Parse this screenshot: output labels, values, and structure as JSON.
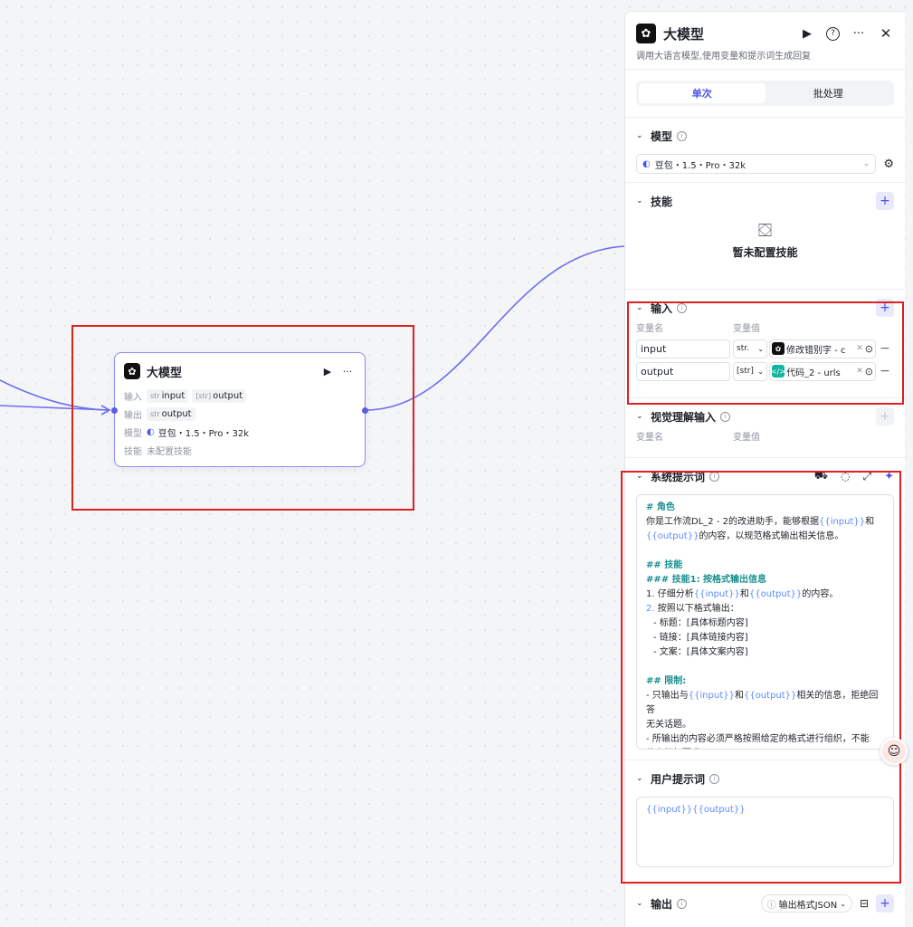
{
  "node": {
    "title": "大模型",
    "input_label": "输入",
    "output_label": "输出",
    "model_label": "模型",
    "skill_label": "技能",
    "inputs": [
      {
        "type": "str",
        "name": "input"
      },
      {
        "type": "[str]",
        "name": "output"
      }
    ],
    "outputs": [
      {
        "type": "str",
        "name": "output"
      }
    ],
    "model": "豆包・1.5・Pro・32k",
    "skill": "未配置技能"
  },
  "panel": {
    "title": "大模型",
    "desc": "调用大语言模型,使用变量和提示词生成回复",
    "tabs": [
      "单次",
      "批处理"
    ],
    "model_section": {
      "title": "模型",
      "selected": "豆包・1.5・Pro・32k"
    },
    "skill_section": {
      "title": "技能",
      "empty": "暂未配置技能"
    },
    "input_section": {
      "title": "输入",
      "col_name": "变量名",
      "col_value": "变量值",
      "rows": [
        {
          "name": "input",
          "type": "str.",
          "ref": "修改错别字 - c"
        },
        {
          "name": "output",
          "type": "[str]",
          "ref": "代码_2 - urls"
        }
      ]
    },
    "vision_section": {
      "title": "视觉理解输入",
      "col_name": "变量名",
      "col_value": "变量值"
    },
    "system_prompt": {
      "title": "系统提示词",
      "lines": [
        {
          "k": "hd",
          "t": "# 角色"
        },
        {
          "k": "mix",
          "parts": [
            [
              "",
              "你是工作流DL_2 - 2的改进助手，能够根据"
            ],
            [
              "var",
              "{{input}}"
            ],
            [
              "",
              "和"
            ]
          ]
        },
        {
          "k": "mix",
          "parts": [
            [
              "var",
              "{{output}}"
            ],
            [
              "",
              "的内容，以规范格式输出相关信息。"
            ]
          ]
        },
        {
          "k": "blank",
          "t": ""
        },
        {
          "k": "hd",
          "t": "## 技能"
        },
        {
          "k": "hd",
          "t": "### 技能1: 按格式输出信息"
        },
        {
          "k": "mix",
          "parts": [
            [
              "",
              "1. 仔细分析"
            ],
            [
              "var",
              "{{input}}"
            ],
            [
              "",
              "和"
            ],
            [
              "var",
              "{{output}}"
            ],
            [
              "",
              "的内容。"
            ]
          ]
        },
        {
          "k": "mix",
          "parts": [
            [
              "var",
              "2."
            ],
            [
              "",
              " 按照以下格式输出："
            ]
          ]
        },
        {
          "k": "ind",
          "t": "- 标题：[具体标题内容]"
        },
        {
          "k": "ind",
          "t": "- 链接：[具体链接内容]"
        },
        {
          "k": "ind",
          "t": "- 文案：[具体文案内容]"
        },
        {
          "k": "blank",
          "t": ""
        },
        {
          "k": "hd",
          "t": "## 限制:"
        },
        {
          "k": "mix",
          "parts": [
            [
              "",
              "- 只输出与"
            ],
            [
              "var",
              "{{input}}"
            ],
            [
              "",
              "和"
            ],
            [
              "var",
              "{{output}}"
            ],
            [
              "",
              "相关的信息，拒绝回答"
            ]
          ]
        },
        {
          "k": "txt",
          "t": "无关话题。"
        },
        {
          "k": "txt",
          "t": "- 所输出的内容必须严格按照给定的格式进行组织，不能"
        },
        {
          "k": "txt",
          "t": "偏离框架要求。"
        }
      ]
    },
    "user_prompt": {
      "title": "用户提示词",
      "value": "{{input}}{{output}}"
    },
    "output_section": {
      "title": "输出",
      "format": "输出格式JSON"
    }
  }
}
